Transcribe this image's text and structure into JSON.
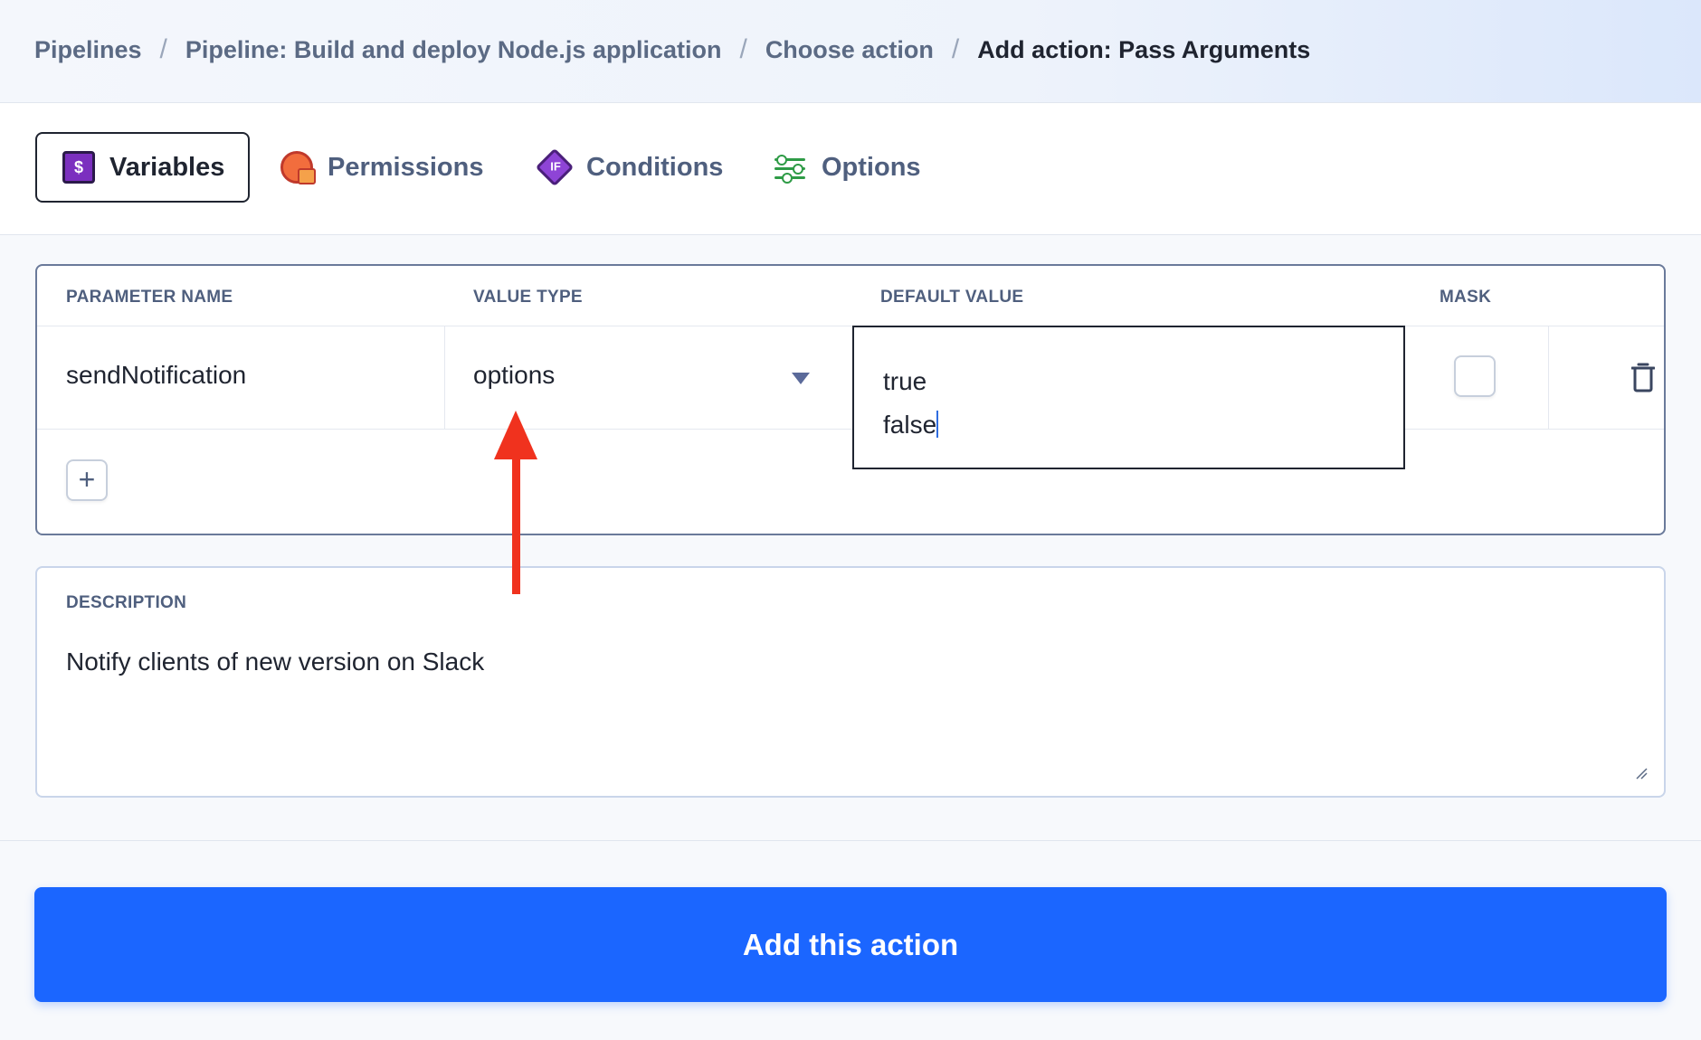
{
  "breadcrumb": {
    "items": [
      "Pipelines",
      "Pipeline: Build and deploy Node.js application",
      "Choose action"
    ],
    "current": "Add action: Pass Arguments",
    "separator": "/"
  },
  "tabs": [
    {
      "label": "Variables",
      "icon": "variables-icon",
      "active": true,
      "glyph": "$"
    },
    {
      "label": "Permissions",
      "icon": "permissions-icon",
      "active": false
    },
    {
      "label": "Conditions",
      "icon": "conditions-icon",
      "active": false,
      "glyph": "IF"
    },
    {
      "label": "Options",
      "icon": "options-icon",
      "active": false
    }
  ],
  "table": {
    "headers": {
      "parameter_name": "PARAMETER NAME",
      "value_type": "VALUE TYPE",
      "default_value": "DEFAULT VALUE",
      "mask": "MASK"
    },
    "rows": [
      {
        "parameter_name": "sendNotification",
        "value_type": "options",
        "default_value_lines": [
          "true",
          "false"
        ],
        "mask": false
      }
    ],
    "add_row_symbol": "+"
  },
  "description": {
    "label": "DESCRIPTION",
    "value": "Notify clients of new version on Slack"
  },
  "submit_button": {
    "label": "Add this action"
  },
  "colors": {
    "primary": "#1b66ff",
    "annotation_arrow": "#f0321e",
    "text_dark": "#1f2430",
    "text_muted": "#4f5f7e"
  }
}
